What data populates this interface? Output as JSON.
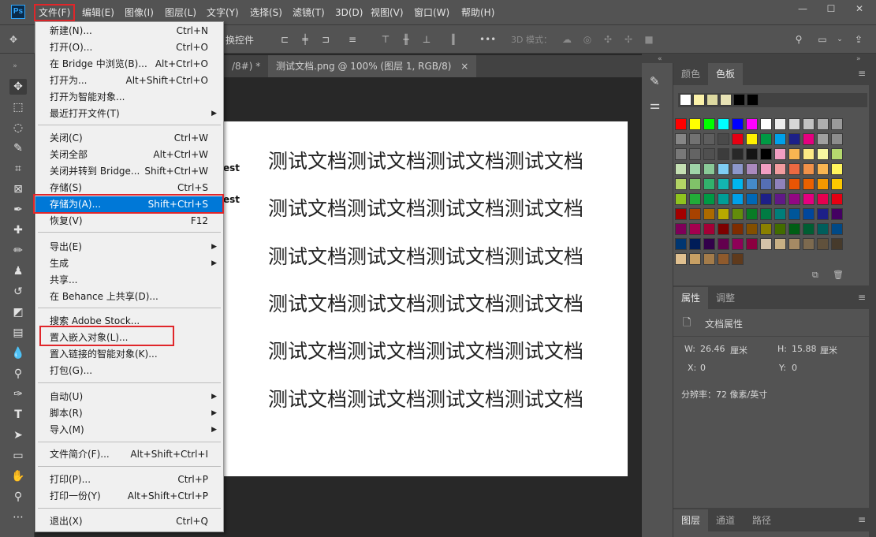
{
  "app": {
    "logo_text": "Ps"
  },
  "menubar": {
    "items": [
      "文件(F)",
      "编辑(E)",
      "图像(I)",
      "图层(L)",
      "文字(Y)",
      "选择(S)",
      "滤镜(T)",
      "3D(D)",
      "视图(V)",
      "窗口(W)",
      "帮助(H)"
    ]
  },
  "window_controls": {
    "minimize": "—",
    "maximize": "☐",
    "close": "✕"
  },
  "options_bar": {
    "control_text": "换控件",
    "mode_3d_label": "3D 模式："
  },
  "document_tabs": [
    {
      "label": "/8#) *",
      "close": "×"
    },
    {
      "label": "测试文档.png @ 100% (图层 1, RGB/8)",
      "close": "×"
    }
  ],
  "canvas": {
    "lines": [
      "测试文档测试文档测试文档测试文档",
      "测试文档测试文档测试文档测试文档",
      "测试文档测试文档测试文档测试文档",
      "测试文档测试文档测试文档测试文档",
      "测试文档测试文档测试文档测试文档",
      "测试文档测试文档测试文档测试文档"
    ],
    "partial_texts": [
      "est",
      "est"
    ]
  },
  "file_menu": {
    "items": [
      {
        "label": "新建(N)...",
        "shortcut": "Ctrl+N"
      },
      {
        "label": "打开(O)...",
        "shortcut": "Ctrl+O"
      },
      {
        "label": "在 Bridge 中浏览(B)...",
        "shortcut": "Alt+Ctrl+O"
      },
      {
        "label": "打开为...",
        "shortcut": "Alt+Shift+Ctrl+O"
      },
      {
        "label": "打开为智能对象...",
        "shortcut": ""
      },
      {
        "label": "最近打开文件(T)",
        "shortcut": "",
        "submenu": true
      },
      {
        "label": "关闭(C)",
        "shortcut": "Ctrl+W"
      },
      {
        "label": "关闭全部",
        "shortcut": "Alt+Ctrl+W"
      },
      {
        "label": "关闭并转到 Bridge...",
        "shortcut": "Shift+Ctrl+W"
      },
      {
        "label": "存储(S)",
        "shortcut": "Ctrl+S"
      },
      {
        "label": "存储为(A)...",
        "shortcut": "Shift+Ctrl+S",
        "highlighted": true
      },
      {
        "label": "恢复(V)",
        "shortcut": "F12"
      },
      {
        "label": "导出(E)",
        "shortcut": "",
        "submenu": true
      },
      {
        "label": "生成",
        "shortcut": "",
        "submenu": true
      },
      {
        "label": "共享...",
        "shortcut": ""
      },
      {
        "label": "在 Behance 上共享(D)...",
        "shortcut": ""
      },
      {
        "label": "搜索 Adobe Stock...",
        "shortcut": ""
      },
      {
        "label": "置入嵌入对象(L)...",
        "shortcut": ""
      },
      {
        "label": "置入链接的智能对象(K)...",
        "shortcut": ""
      },
      {
        "label": "打包(G)...",
        "shortcut": ""
      },
      {
        "label": "自动(U)",
        "shortcut": "",
        "submenu": true
      },
      {
        "label": "脚本(R)",
        "shortcut": "",
        "submenu": true
      },
      {
        "label": "导入(M)",
        "shortcut": "",
        "submenu": true
      },
      {
        "label": "文件简介(F)...",
        "shortcut": "Alt+Shift+Ctrl+I"
      },
      {
        "label": "打印(P)...",
        "shortcut": "Ctrl+P"
      },
      {
        "label": "打印一份(Y)",
        "shortcut": "Alt+Shift+Ctrl+P"
      },
      {
        "label": "退出(X)",
        "shortcut": "Ctrl+Q"
      }
    ]
  },
  "color_panel": {
    "tabs": [
      "颜色",
      "色板"
    ],
    "recent_swatches": [
      "#ffffff",
      "#fbf2a9",
      "#ddd9a0",
      "#e8e3b5",
      "#000000",
      "#000000"
    ],
    "swatches": [
      "#ff0000",
      "#ffff00",
      "#00ff00",
      "#00ffff",
      "#0000ff",
      "#ff00ff",
      "#ffffff",
      "#ececec",
      "#d6d6d6",
      "#c2c2c2",
      "#aeaeae",
      "#9a9a9a",
      "#868686",
      "#727272",
      "#5e5e5e",
      "#4a4a4a",
      "#e60012",
      "#fff100",
      "#009944",
      "#00a0e9",
      "#1d2088",
      "#e4007f",
      "#a0a0a0",
      "#8c8c8c",
      "#787878",
      "#646464",
      "#505050",
      "#3c3c3c",
      "#282828",
      "#141414",
      "#000000",
      "#f19ec2",
      "#f8b551",
      "#fce985",
      "#f6f6a0",
      "#b5d96e",
      "#c5e0b3",
      "#9fd4a8",
      "#89c997",
      "#7ecef4",
      "#8c97cb",
      "#aa89bd",
      "#f19ec2",
      "#f29c9f",
      "#ec6941",
      "#f19149",
      "#f8b551",
      "#fff45c",
      "#b3d465",
      "#80c269",
      "#32b16c",
      "#13b5b1",
      "#00b7ee",
      "#448aca",
      "#556fb5",
      "#8f82bc",
      "#e95504",
      "#eb6100",
      "#f39800",
      "#fcc800",
      "#8fc31f",
      "#22ac38",
      "#009944",
      "#009e96",
      "#00a0e9",
      "#0068b7",
      "#1d2088",
      "#601986",
      "#920783",
      "#e4007f",
      "#e5004f",
      "#e60012",
      "#a40000",
      "#a84200",
      "#ac6a00",
      "#b7aa00",
      "#638c0b",
      "#097c25",
      "#007b43",
      "#007e7a",
      "#00569a",
      "#00479d",
      "#1d2088",
      "#440062",
      "#7e0059",
      "#a4004f",
      "#a40036",
      "#7d0000",
      "#7f2c00",
      "#834f00",
      "#8a8000",
      "#426c00",
      "#005e15",
      "#005e33",
      "#005e5c",
      "#004986",
      "#003671",
      "#001c58",
      "#32004a",
      "#63004e",
      "#8f0058",
      "#8b0040",
      "#d4c2a9",
      "#c8b084",
      "#a68a64",
      "#7d6a4f",
      "#60513c",
      "#463a2b",
      "#e0c090",
      "#c8a064",
      "#a47c4a",
      "#8f5a2c",
      "#5f3a1c"
    ]
  },
  "properties_panel": {
    "tabs": [
      "属性",
      "调整"
    ],
    "title": "文档属性",
    "w_label": "W:",
    "w_value": "26.46",
    "w_unit": "厘米",
    "h_label": "H:",
    "h_value": "15.88",
    "h_unit": "厘米",
    "x_label": "X:",
    "x_value": "0",
    "y_label": "Y:",
    "y_value": "0",
    "resolution": "分辨率：72 像素/英寸"
  },
  "layers_panel": {
    "tabs": [
      "图层",
      "通道",
      "路径"
    ]
  }
}
